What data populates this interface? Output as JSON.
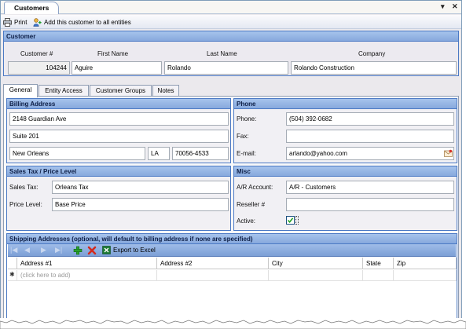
{
  "window": {
    "title": "Customers",
    "pin_glyph": "▾",
    "close_glyph": "✕"
  },
  "toolbar": {
    "print_label": "Print",
    "add_all_label": "Add this customer to all entities"
  },
  "customer": {
    "header": "Customer",
    "labels": {
      "number": "Customer #",
      "first_name": "First Name",
      "last_name": "Last Name",
      "company": "Company"
    },
    "number": "104244",
    "first_name": "Aguire",
    "last_name": "Rolando",
    "company": "Rolando Construction"
  },
  "tabs": [
    "General",
    "Entity Access",
    "Customer Groups",
    "Notes"
  ],
  "billing": {
    "header": "Billing Address",
    "line1": "2148 Guardian Ave",
    "line2": "Suite 201",
    "city": "New Orleans",
    "state": "LA",
    "zip": "70056-4533"
  },
  "phone": {
    "header": "Phone",
    "phone_label": "Phone:",
    "phone": "(504) 392-0682",
    "fax_label": "Fax:",
    "fax": "",
    "email_label": "E-mail:",
    "email": "arlando@yahoo.com"
  },
  "sales_tax": {
    "header": "Sales Tax / Price Level",
    "tax_label": "Sales Tax:",
    "tax": "Orleans Tax",
    "price_label": "Price Level:",
    "price": "Base Price"
  },
  "misc": {
    "header": "Misc",
    "ar_label": "A/R Account:",
    "ar": "A/R - Customers",
    "reseller_label": "Reseller #",
    "reseller": "",
    "active_label": "Active:",
    "active": true
  },
  "shipping": {
    "header": "Shipping Addresses (optional, will default to billing address if none are specified)",
    "export_label": "Export to Excel",
    "columns": [
      "Address #1",
      "Address #2",
      "City",
      "State",
      "Zip"
    ],
    "new_row_marker": "✱",
    "add_placeholder": "(click here to add)"
  },
  "colors": {
    "group_header": "#87a9dd",
    "group_border": "#4b79c4",
    "panel": "#eceaf0"
  }
}
